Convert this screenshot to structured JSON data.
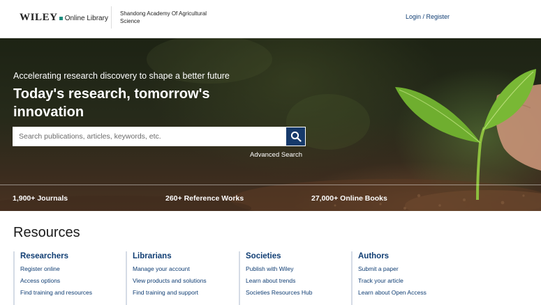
{
  "header": {
    "logo_wiley": "WILEY",
    "logo_online_library": "Online Library",
    "institution": "Shandong Academy Of Agricultural Science",
    "login_label": "Login / Register"
  },
  "hero": {
    "tagline": "Accelerating research discovery to shape a better future",
    "headline": "Today's research, tomorrow's innovation",
    "search_placeholder": "Search publications, articles, keywords, etc.",
    "search_value": "",
    "advanced_search_label": "Advanced Search",
    "stats": [
      {
        "label": "1,900+ Journals"
      },
      {
        "label": "260+ Reference Works"
      },
      {
        "label": "27,000+ Online Books"
      }
    ]
  },
  "resources": {
    "title": "Resources",
    "columns": [
      {
        "title": "Researchers",
        "links": [
          "Register online",
          "Access options",
          "Find training and resources"
        ]
      },
      {
        "title": "Librarians",
        "links": [
          "Manage your account",
          "View products and solutions",
          "Find training and support"
        ]
      },
      {
        "title": "Societies",
        "links": [
          "Publish with Wiley",
          "Learn about trends",
          "Societies Resources Hub"
        ]
      },
      {
        "title": "Authors",
        "links": [
          "Submit a paper",
          "Track your article",
          "Learn about Open Access"
        ]
      }
    ]
  },
  "colors": {
    "brand_navy": "#163a6b",
    "link_blue": "#0f3d73",
    "logo_dot_green": "#1e8c7e"
  },
  "icons": {
    "search_button": "magnifier-icon",
    "logo_mark": "square-dot-icon"
  }
}
